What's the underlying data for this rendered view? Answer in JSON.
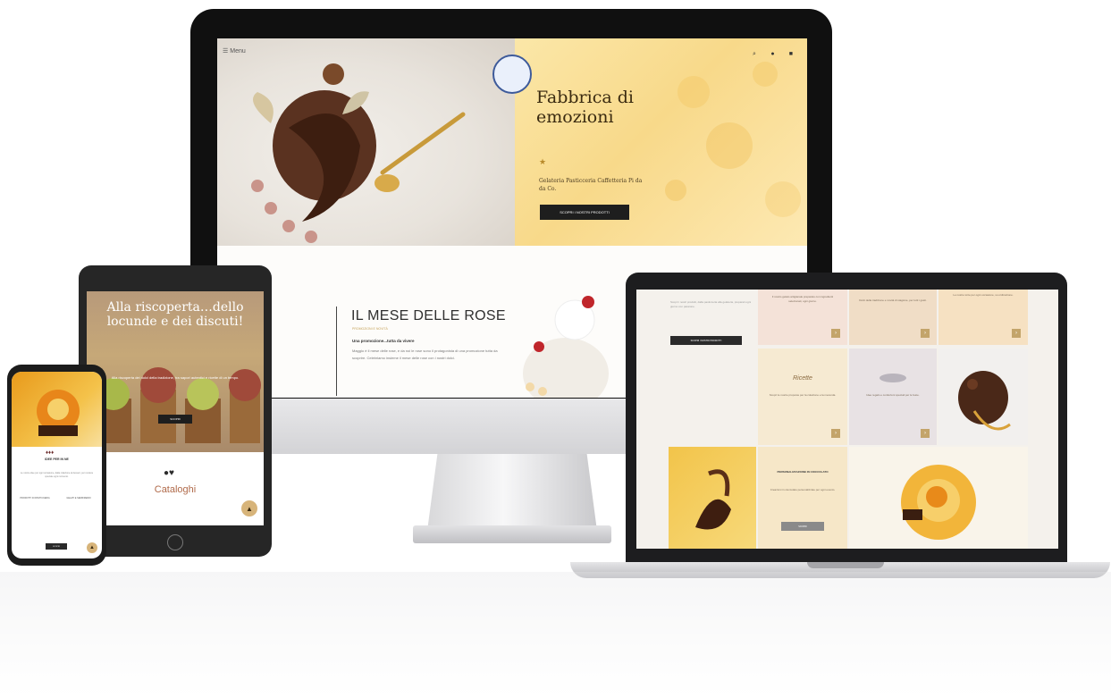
{
  "desktop": {
    "menu_label": "Menu",
    "hero_title": "Fabbrica di emozioni",
    "hero_stars": "★",
    "hero_subtitle": "Gelateria Pasticceria Caffetteria Pi da da Co.",
    "hero_button": "SCOPRI I NOSTRI PRODOTTI",
    "section_title": "IL MESE DELLE ROSE",
    "section_kicker": "PROMOZIONI E NOVITÀ",
    "section_lead": "Una promozione...tutta da vivere",
    "section_body": "Maggio è il mese delle rose, e da noi le rose sono il protagonista di una promozione tutta da scoprire. Celebriamo insieme il mese delle rose con i nostri dolci."
  },
  "tablet": {
    "title": "Alla riscoperta…dello locunde e dei discuti!",
    "body": "Alla riscoperta dei dolci della tradizione, tra sapori autentici e ricette di un tempo.",
    "button": "SCOPRI",
    "section_title": "Cataloghi"
  },
  "phone": {
    "heading": "IDEE PER IN NE",
    "text": "Le nostre idee per ogni occasione, dalla colazione al dessert, per rendere speciale ogni momento.",
    "item_left": "PRODOTTI DI PASTICCERIA",
    "item_right": "GELATI E SEMIFREDDI",
    "button": "SCOPRI"
  },
  "laptop": {
    "intro_text": "Scopri i nostri prodotti, dalla pasticceria alla gelateria, preparati ogni giorno con passione.",
    "intro_button": "SCOPRI I NOSTRI PRODOTTI",
    "tile_texts": [
      "Il nostro gelato artigianale preparato con ingredienti selezionati, ogni giorno.",
      "Dolci della tradizione e novità di stagione, per tutti i gusti.",
      "Le nostre torte per ogni occasione, su ordinazione.",
      "Scopri le nostre proposte per la colazione e la merenda.",
      "Idee regalo e confezioni speciali per le feste."
    ],
    "tile_script_1": "Ricette",
    "chocolate_heading": "PERSONALIZZAZIONE IN CIOCCOLATO",
    "chocolate_text": "Creazioni in cioccolato personalizzate per ogni evento.",
    "chocolate_button": "SCOPRI"
  },
  "colors": {
    "hero_yellow": "#f8d98a",
    "dark": "#1e1e1e",
    "gold": "#c3a46a",
    "rose_title": "#2f2f2f",
    "catalog": "#b06a4a"
  },
  "icons": [
    "menu-icon",
    "logo-emblem",
    "search-icon",
    "user-icon",
    "cart-icon",
    "arrow-up-icon",
    "arrow-right-icon"
  ]
}
